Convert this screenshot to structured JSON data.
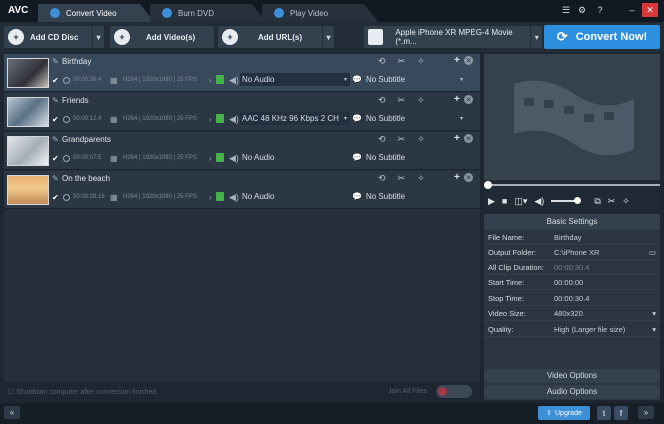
{
  "app": {
    "logo": "AVC"
  },
  "tabs": [
    {
      "label": "Convert Video",
      "active": true
    },
    {
      "label": "Burn DVD",
      "active": false
    },
    {
      "label": "Play Video",
      "active": false
    }
  ],
  "window_icons": [
    "list-icon",
    "gear-icon",
    "help-icon",
    "minimize-icon",
    "close-icon"
  ],
  "toolbar": {
    "add_cd": "Add CD Disc",
    "add_video": "Add Video(s)",
    "add_url": "Add URL(s)",
    "profile": "Apple iPhone XR MPEG-4 Movie (*.m...",
    "convert": "Convert Now!"
  },
  "files": [
    {
      "title": "Birthday",
      "duration": "00:00:30.4",
      "video_info": "H264 | 1920x1080 | 25 FPS",
      "audio": "No Audio",
      "subtitle": "No Subtitle",
      "selected": true
    },
    {
      "title": "Friends",
      "duration": "00:00:12.4",
      "video_info": "H264 | 1920x1080 | 25 FPS",
      "audio": "AAC 48 KHz 96 Kbps 2 CH",
      "subtitle": "No Subtitle",
      "selected": false
    },
    {
      "title": "Grandparents",
      "duration": "00:00:07.5",
      "video_info": "H264 | 1920x1080 | 25 FPS",
      "audio": "No Audio",
      "subtitle": "No Subtitle",
      "selected": false
    },
    {
      "title": "On the beach",
      "duration": "00:00:28.16",
      "video_info": "H264 | 1920x1080 | 25 FPS",
      "audio": "No Audio",
      "subtitle": "No Subtitle",
      "selected": false
    }
  ],
  "bottom": {
    "shutdown": "Shutdown computer after conversion finished",
    "join_all": "Join All Files"
  },
  "settings": {
    "header": "Basic Settings",
    "rows": [
      {
        "label": "File Name:",
        "value": "Birthday"
      },
      {
        "label": "Output Folder:",
        "value": "C:\\iPhone XR"
      },
      {
        "label": "All Clip Duration:",
        "value": "00:00:30.4"
      },
      {
        "label": "Start Time:",
        "value": "00:00:00"
      },
      {
        "label": "Stop Time:",
        "value": "00:00:30.4"
      },
      {
        "label": "Video Size:",
        "value": "480x320"
      },
      {
        "label": "Quality:",
        "value": "High (Larger file size)"
      }
    ],
    "video_options": "Video Options",
    "audio_options": "Audio Options"
  },
  "statusbar": {
    "upgrade": "Upgrade",
    "prev": "«",
    "next": "»"
  },
  "colors": {
    "accent": "#2d8fe0",
    "background": "#1d2631",
    "selected_row": "#38495c"
  }
}
